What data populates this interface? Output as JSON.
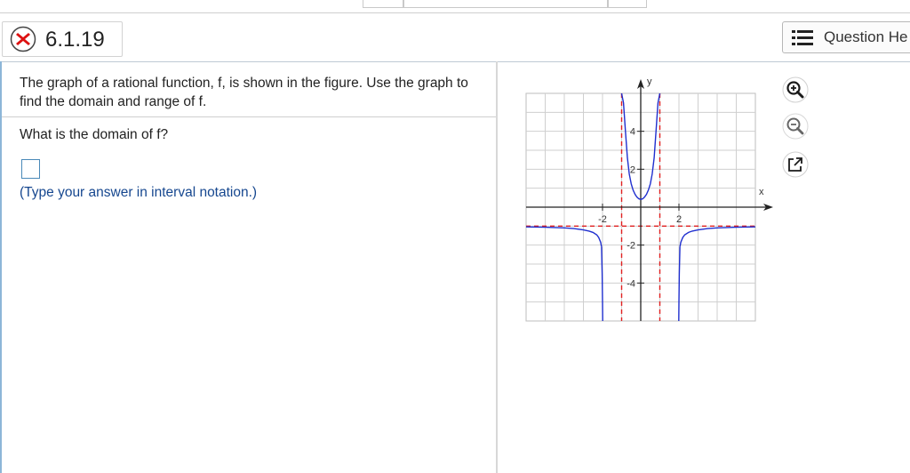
{
  "header": {
    "question_id": "6.1.19",
    "status_icon": "x-mark-icon",
    "help_button_label": "Question He",
    "help_icon": "list-icon"
  },
  "problem": {
    "prompt": "The graph of a rational function, f, is shown in the figure. Use the graph to find  the domain and range of f.",
    "question": "What is the domain of f?",
    "answer_value": "",
    "hint": "(Type your answer in interval notation.)"
  },
  "tools": [
    {
      "name": "zoom-in-icon"
    },
    {
      "name": "zoom-out-icon"
    },
    {
      "name": "pop-out-icon"
    }
  ],
  "chart_data": {
    "type": "line",
    "xlabel": "x",
    "ylabel": "y",
    "xlim": [
      -6,
      6
    ],
    "ylim": [
      -6,
      6
    ],
    "x_ticks": [
      -2,
      2
    ],
    "y_ticks": [
      -4,
      -2,
      2,
      4
    ],
    "grid": true,
    "series": [
      {
        "x": [
          -1,
          -0.9,
          -0.8,
          -0.7,
          -0.6,
          -0.5,
          -0.4,
          -0.3,
          -0.2,
          -0.1,
          0,
          0.1,
          0.2,
          0.3,
          0.4,
          0.5,
          0.6,
          0.7,
          0.8,
          0.9,
          1
        ],
        "y": [
          6.0,
          5.5,
          4.0,
          2.6,
          1.75,
          1.23,
          0.9,
          0.68,
          0.53,
          0.44,
          0.41,
          0.44,
          0.53,
          0.68,
          0.9,
          1.23,
          1.75,
          2.6,
          4.0,
          5.5,
          6.0
        ]
      },
      {
        "x": [
          -6,
          -5,
          -4,
          -3.5,
          -3,
          -2.7,
          -2.5,
          -2.3,
          -2.2,
          -2.1,
          -2.05
        ],
        "y": [
          -1.04,
          -1.06,
          -1.09,
          -1.13,
          -1.2,
          -1.26,
          -1.33,
          -1.46,
          -1.6,
          -1.85,
          -2.1
        ]
      },
      {
        "x": [
          2.05,
          2.1,
          2.2,
          2.3,
          2.5,
          2.7,
          3,
          3.5,
          4,
          5,
          6
        ],
        "y": [
          -2.1,
          -1.85,
          -1.6,
          -1.46,
          -1.33,
          -1.26,
          -1.2,
          -1.13,
          -1.09,
          -1.06,
          -1.04
        ]
      },
      {
        "x": [
          -2.05,
          -2.02,
          -2.0,
          -1.99
        ],
        "y": [
          -2.1,
          -3.5,
          -5.0,
          -6.0
        ]
      },
      {
        "x": [
          1.99,
          2.0,
          2.02,
          2.05
        ],
        "y": [
          -6.0,
          -5.0,
          -3.5,
          -2.1
        ]
      }
    ],
    "asymptotes": {
      "vertical": [
        -1,
        1
      ],
      "horizontal": [
        -1
      ]
    },
    "colors": {
      "curve": "#1f2fcf",
      "asymptote": "#e02020",
      "grid": "#cfcfcf"
    }
  }
}
